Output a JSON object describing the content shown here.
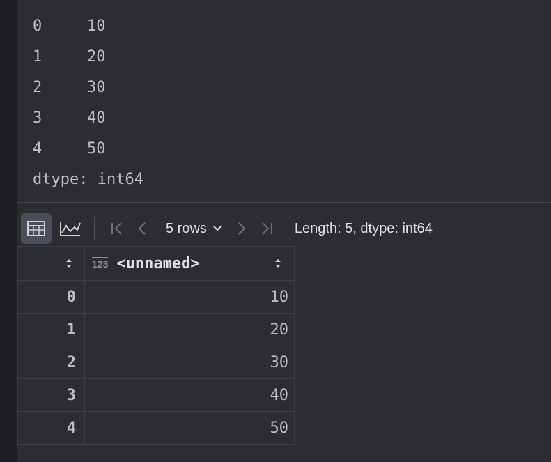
{
  "console": {
    "lines": [
      {
        "index": "0",
        "value": "10"
      },
      {
        "index": "1",
        "value": "20"
      },
      {
        "index": "2",
        "value": "30"
      },
      {
        "index": "3",
        "value": "40"
      },
      {
        "index": "4",
        "value": "50"
      }
    ],
    "dtype_line": "dtype: int64"
  },
  "viewer": {
    "toolbar": {
      "table_view_icon": "table-icon",
      "chart_view_icon": "chart-icon",
      "rows_label": "5 rows",
      "summary": "Length: 5, dtype: int64"
    },
    "table": {
      "column_type_badge": "123",
      "column_name": "<unnamed>",
      "rows": [
        {
          "index": "0",
          "value": "10"
        },
        {
          "index": "1",
          "value": "20"
        },
        {
          "index": "2",
          "value": "30"
        },
        {
          "index": "3",
          "value": "40"
        },
        {
          "index": "4",
          "value": "50"
        }
      ]
    }
  }
}
